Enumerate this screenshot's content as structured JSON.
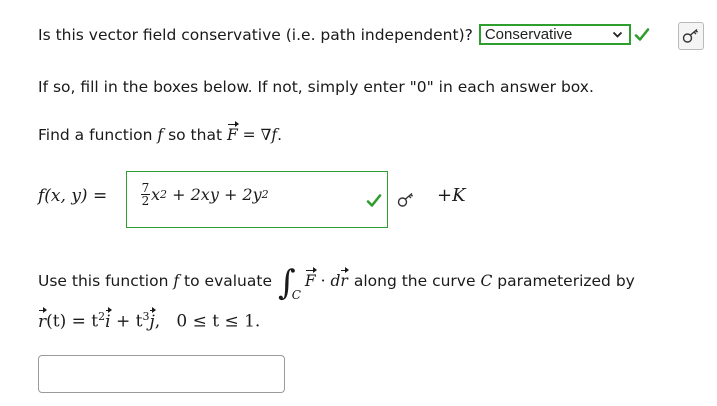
{
  "question": {
    "text": "Is this vector field conservative (i.e. path independent)?",
    "select_value": "Conservative",
    "status": "correct"
  },
  "instructions": "If so, fill in the boxes below.  If not, simply enter \"0\" in each answer box.",
  "find": {
    "prefix": "Find a function",
    "f": "f",
    "so_that": "so that",
    "F": "F",
    "eq": "= ∇",
    "f2": "f",
    "period": "."
  },
  "formula": {
    "label": "f(x, y) =",
    "answer_prefix_num": "7",
    "answer_prefix_den": "2",
    "answer_rest_a": "x",
    "answer_rest_a_exp": "2",
    "answer_rest_b": " + 2xy + 2y",
    "answer_rest_b_exp": "2",
    "status": "correct",
    "suffix": "+K"
  },
  "use": {
    "prefix": "Use this function",
    "f": "f",
    "mid": "to evaluate",
    "integrand_F": "F",
    "dot": "·",
    "d": "d",
    "r": "r",
    "after": "along the curve",
    "C": "C",
    "end": "parameterized by",
    "integral_sub": "C"
  },
  "param": {
    "r": "r",
    "lhs": "(t) = t",
    "exp1": "2",
    "i": "i",
    "plus": " + t",
    "exp2": "3",
    "j": "j",
    "range": ",   0 ≤ t ≤ 1."
  },
  "answer2": {
    "value": ""
  },
  "colors": {
    "correct": "#2e9e2e",
    "text": "#1a1a1a"
  },
  "icons": {
    "check": "check-icon",
    "key": "key-icon"
  }
}
